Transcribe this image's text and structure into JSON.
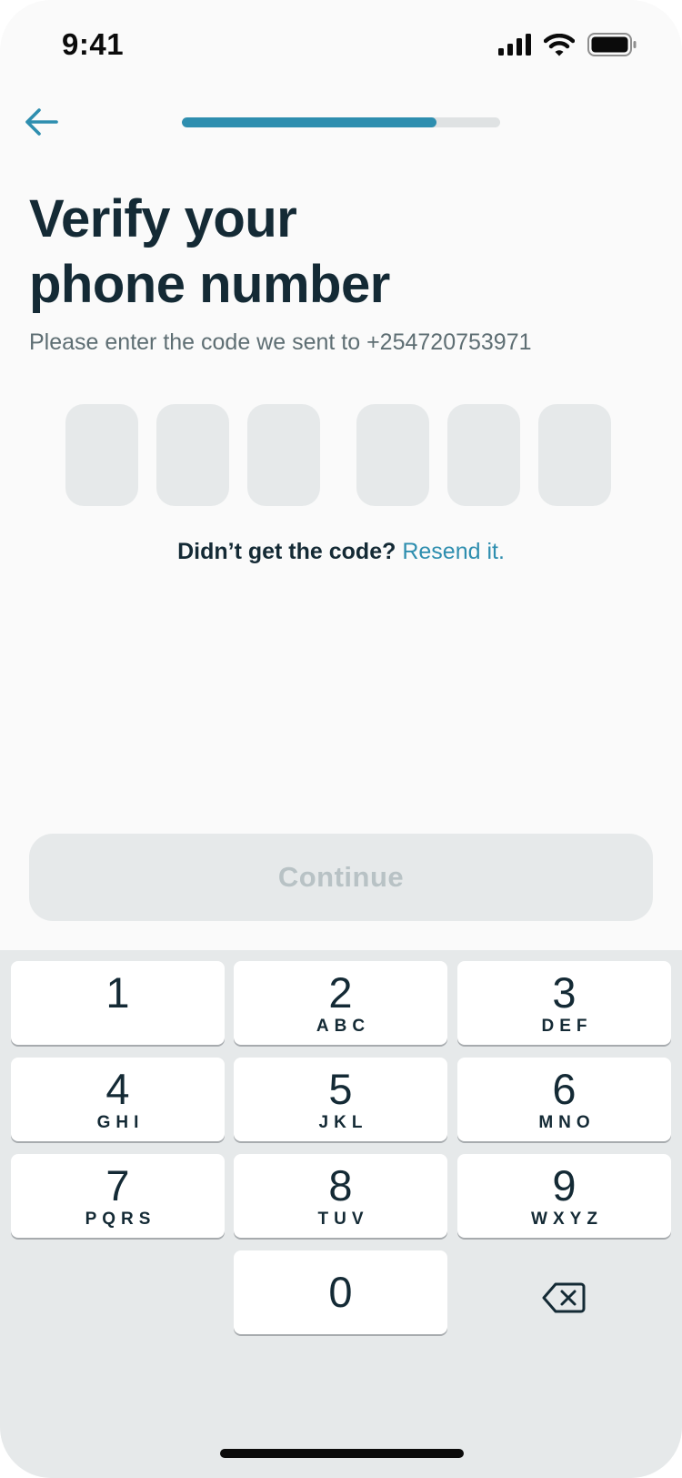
{
  "status_bar": {
    "time": "9:41"
  },
  "onboarding": {
    "progress_fraction": 0.8
  },
  "header": {
    "title_line1": "Verify your",
    "title_line2": "phone number"
  },
  "subtitle": "Please enter the code we sent to +254720753971",
  "code_inputs": [
    "",
    "",
    "",
    "",
    "",
    ""
  ],
  "resend": {
    "question": "Didn’t get the code?",
    "link": "Resend it."
  },
  "continue_button": {
    "label": "Continue"
  },
  "keypad": {
    "keys": [
      {
        "digit": "1",
        "letters": ""
      },
      {
        "digit": "2",
        "letters": "ABC"
      },
      {
        "digit": "3",
        "letters": "DEF"
      },
      {
        "digit": "4",
        "letters": "GHI"
      },
      {
        "digit": "5",
        "letters": "JKL"
      },
      {
        "digit": "6",
        "letters": "MNO"
      },
      {
        "digit": "7",
        "letters": "PQRS"
      },
      {
        "digit": "8",
        "letters": "TUV"
      },
      {
        "digit": "9",
        "letters": "WXYZ"
      },
      {
        "digit": "0",
        "letters": ""
      }
    ],
    "delete_icon": "backspace-icon"
  },
  "colors": {
    "accent": "#2e8eaf",
    "text_dark": "#142a35",
    "disabled_bg": "#e6e9ea",
    "disabled_text": "#b8c2c5"
  }
}
